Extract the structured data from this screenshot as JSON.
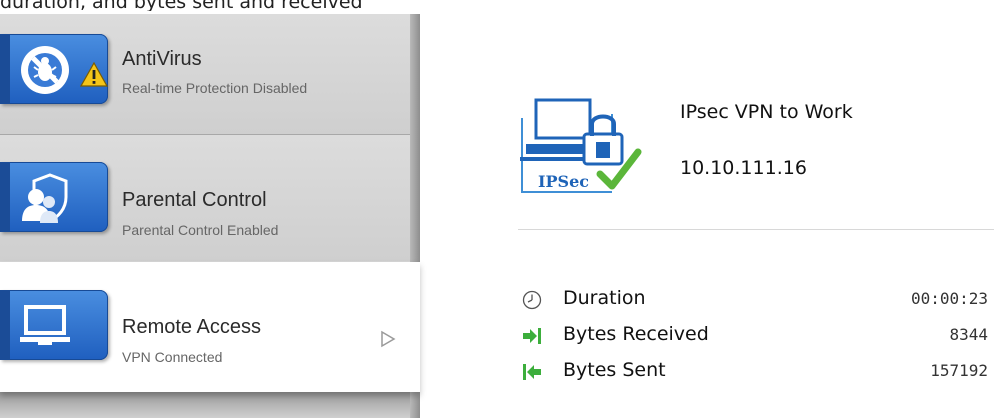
{
  "caption": "duration, and bytes sent and received",
  "sidebar": {
    "items": [
      {
        "title": "AntiVirus",
        "subtitle": "Real-time Protection Disabled",
        "icon": "antivirus-bug-icon",
        "warning": true
      },
      {
        "title": "Parental Control",
        "subtitle": "Parental Control Enabled",
        "icon": "parental-control-icon"
      },
      {
        "title": "Remote Access",
        "subtitle": "VPN Connected",
        "icon": "laptop-icon",
        "selected": true
      }
    ]
  },
  "connection": {
    "name": "IPsec VPN to Work",
    "ip": "10.10.111.16",
    "badge": "IPSec"
  },
  "stats": {
    "duration_label": "Duration",
    "duration_value": "00:00:23",
    "received_label": "Bytes Received",
    "received_value": "8344",
    "sent_label": "Bytes Sent",
    "sent_value": "157192"
  },
  "colors": {
    "tile_blue": "#2b6fd0",
    "check_green": "#5bb63a",
    "arrow_green": "#3cae3c"
  }
}
